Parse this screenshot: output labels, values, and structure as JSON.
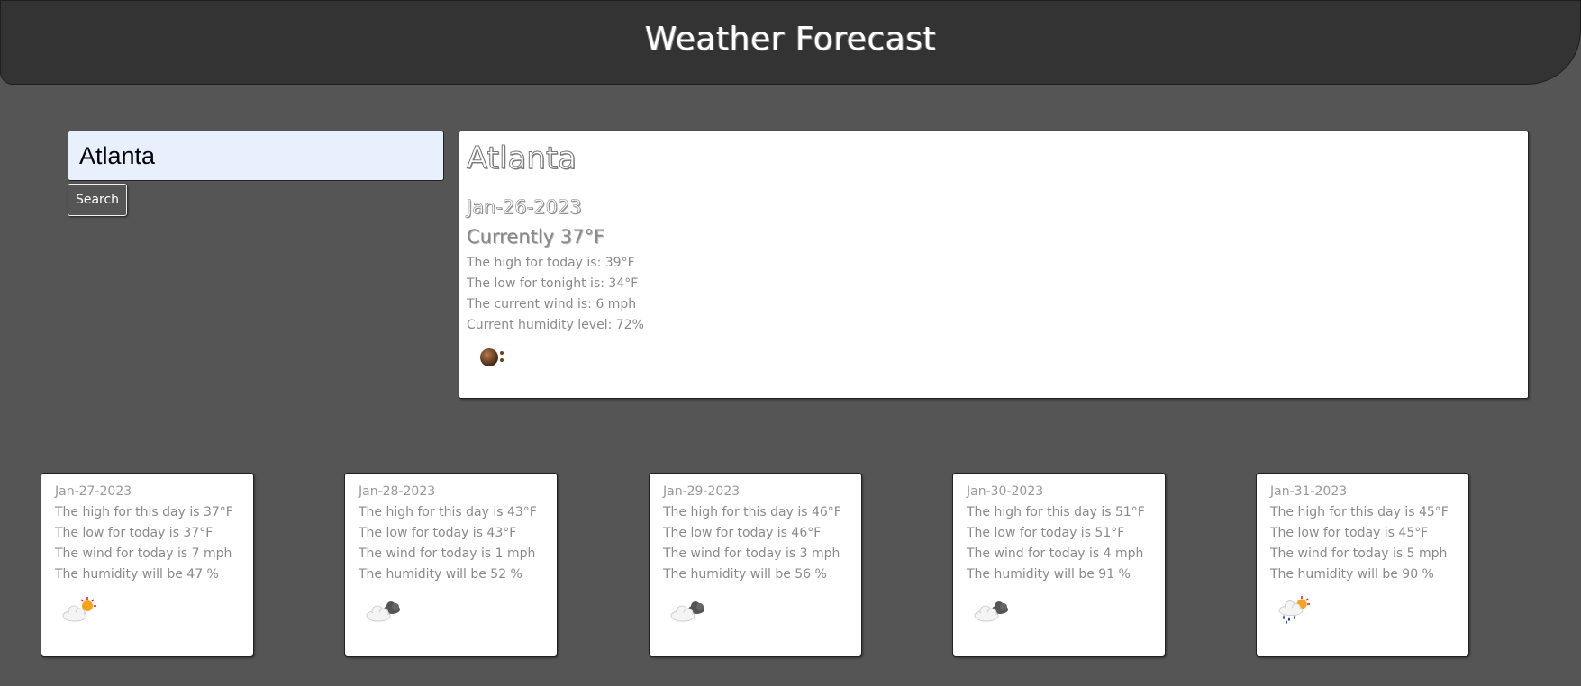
{
  "header": {
    "title": "Weather Forecast"
  },
  "search": {
    "value": "Atlanta",
    "button_label": "Search"
  },
  "current": {
    "city": "Atlanta",
    "date": "Jan-26-2023",
    "currently": "Currently 37°F",
    "high": "The high for today is: 39°F",
    "low": "The low for tonight is: 34°F",
    "wind": "The current wind is: 6 mph",
    "humidity": "Current humidity level: 72%",
    "icon": "haze-icon"
  },
  "forecast": [
    {
      "date": "Jan-27-2023",
      "high": "The high for this day is 37°F",
      "low": "The low for today is 37°F",
      "wind": "The wind for today is 7 mph",
      "humidity": "The humidity will be 47 %",
      "icon": "partly-cloudy-icon"
    },
    {
      "date": "Jan-28-2023",
      "high": "The high for this day is 43°F",
      "low": "The low for today is 43°F",
      "wind": "The wind for today is 1 mph",
      "humidity": "The humidity will be 52 %",
      "icon": "cloudy-icon"
    },
    {
      "date": "Jan-29-2023",
      "high": "The high for this day is 46°F",
      "low": "The low for today is 46°F",
      "wind": "The wind for today is 3 mph",
      "humidity": "The humidity will be 56 %",
      "icon": "cloudy-icon"
    },
    {
      "date": "Jan-30-2023",
      "high": "The high for this day is 51°F",
      "low": "The low for today is 51°F",
      "wind": "The wind for today is 4 mph",
      "humidity": "The humidity will be 91 %",
      "icon": "cloudy-icon"
    },
    {
      "date": "Jan-31-2023",
      "high": "The high for this day is 45°F",
      "low": "The low for today is 45°F",
      "wind": "The wind for today is 5 mph",
      "humidity": "The humidity will be 90 %",
      "icon": "rain-sun-icon"
    }
  ]
}
